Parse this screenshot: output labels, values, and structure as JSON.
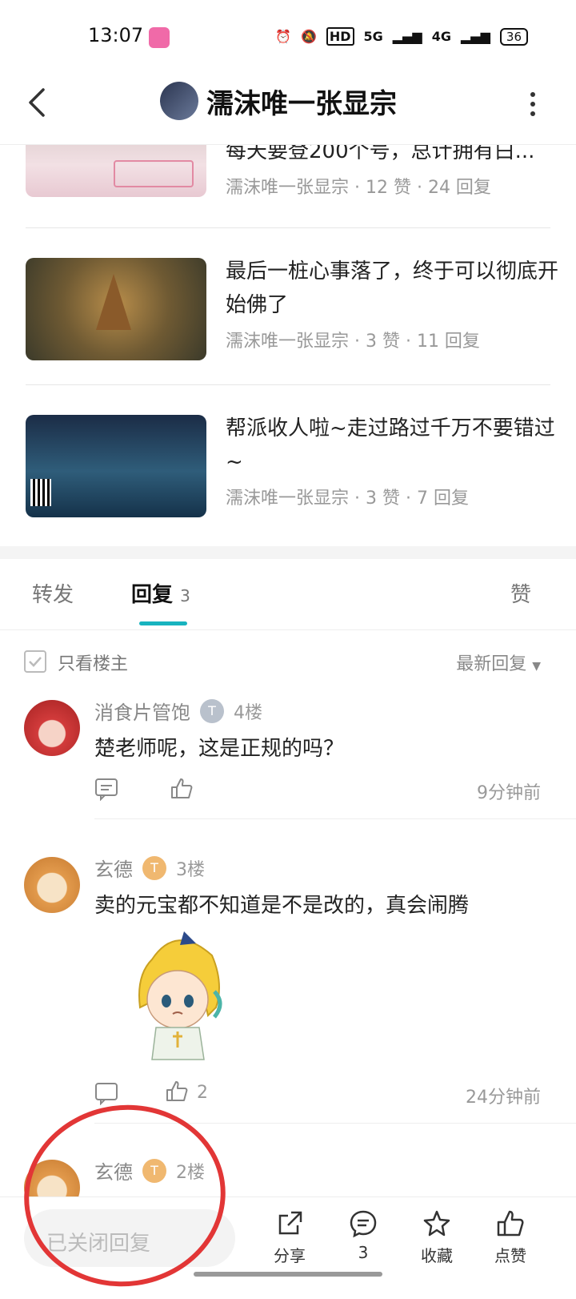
{
  "status_bar": {
    "time": "13:07",
    "network1": "5G",
    "network2": "4G",
    "hd": "HD",
    "battery": "36"
  },
  "header": {
    "title": "濡沫唯一张显宗"
  },
  "related": [
    {
      "title": "每天要登200个号，总计拥有白...",
      "meta": "濡沫唯一张显宗 · 12 赞 · 24 回复"
    },
    {
      "title": "最后一桩心事落了，终于可以彻底开始佛了",
      "meta": "濡沫唯一张显宗 · 3 赞 · 11 回复"
    },
    {
      "title": "帮派收人啦~走过路过千万不要错过~",
      "meta": "濡沫唯一张显宗 · 3 赞 · 7 回复"
    }
  ],
  "tabs": {
    "forward": "转发",
    "reply": "回复",
    "reply_count": "3",
    "like": "赞"
  },
  "filter": {
    "only_op": "只看楼主",
    "sort": "最新回复"
  },
  "comments": [
    {
      "name": "消食片管饱",
      "badge": "T",
      "floor": "4楼",
      "text": "楚老师呢，这是正规的吗？",
      "likes": "",
      "time": "9分钟前"
    },
    {
      "name": "玄德",
      "badge": "T",
      "floor": "3楼",
      "text": "卖的元宝都不知道是不是改的，真会闹腾",
      "likes": "2",
      "time": "24分钟前"
    },
    {
      "name": "玄德",
      "badge": "T",
      "floor": "2楼"
    }
  ],
  "bottom_bar": {
    "reply_placeholder": "已关闭回复",
    "share": "分享",
    "comments_count": "3",
    "favorite": "收藏",
    "like": "点赞"
  }
}
